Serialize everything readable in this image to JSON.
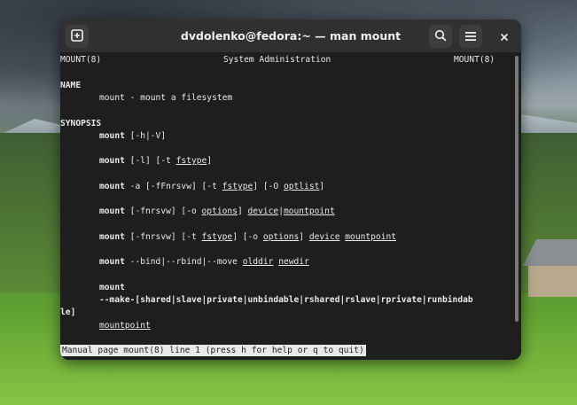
{
  "window": {
    "title": "dvdolenko@fedora:~ — man mount",
    "icons": {
      "new_tab": "new-tab-icon",
      "search": "search-icon",
      "menu": "hamburger-menu-icon",
      "close": "close-icon"
    }
  },
  "man": {
    "header_left": "MOUNT(8)",
    "header_center": "System Administration",
    "header_right": "MOUNT(8)",
    "name_heading": "NAME",
    "name_text": "mount - mount a filesystem",
    "synopsis_heading": "SYNOPSIS",
    "s1": {
      "cmd": "mount",
      "opt": " [-h|-V]"
    },
    "s2": {
      "cmd": "mount",
      "opt": " [-l] [-t ",
      "arg": "fstype",
      "end": "]"
    },
    "s3": {
      "cmd": "mount",
      "opt": " -a [-fFnrsvw] [-t ",
      "arg1": "fstype",
      "mid": "] [-O ",
      "arg2": "optlist",
      "end": "]"
    },
    "s4": {
      "cmd": "mount",
      "opt": " [-fnrsvw] [-o ",
      "arg1": "options",
      "mid": "] ",
      "arg2": "device",
      "sep": "|",
      "arg3": "mountpoint"
    },
    "s5": {
      "cmd": "mount",
      "opt": " [-fnrsvw] [-t ",
      "arg1": "fstype",
      "mid1": "] [-o ",
      "arg2": "options",
      "mid2": "] ",
      "arg3": "device",
      "sp": " ",
      "arg4": "mountpoint"
    },
    "s6": {
      "cmd": "mount",
      "opt": " --bind|--rbind|--move ",
      "arg1": "olddir",
      "sp": " ",
      "arg2": "newdir"
    },
    "s7": {
      "cmd": "mount",
      "make": "--make-[shared|slave|private|unbindable|rshared|rslave|rprivate|runbindab",
      "wrap": "le]",
      "arg": "mountpoint"
    },
    "status": "Manual page mount(8) line 1 (press h for help or q to quit)"
  }
}
